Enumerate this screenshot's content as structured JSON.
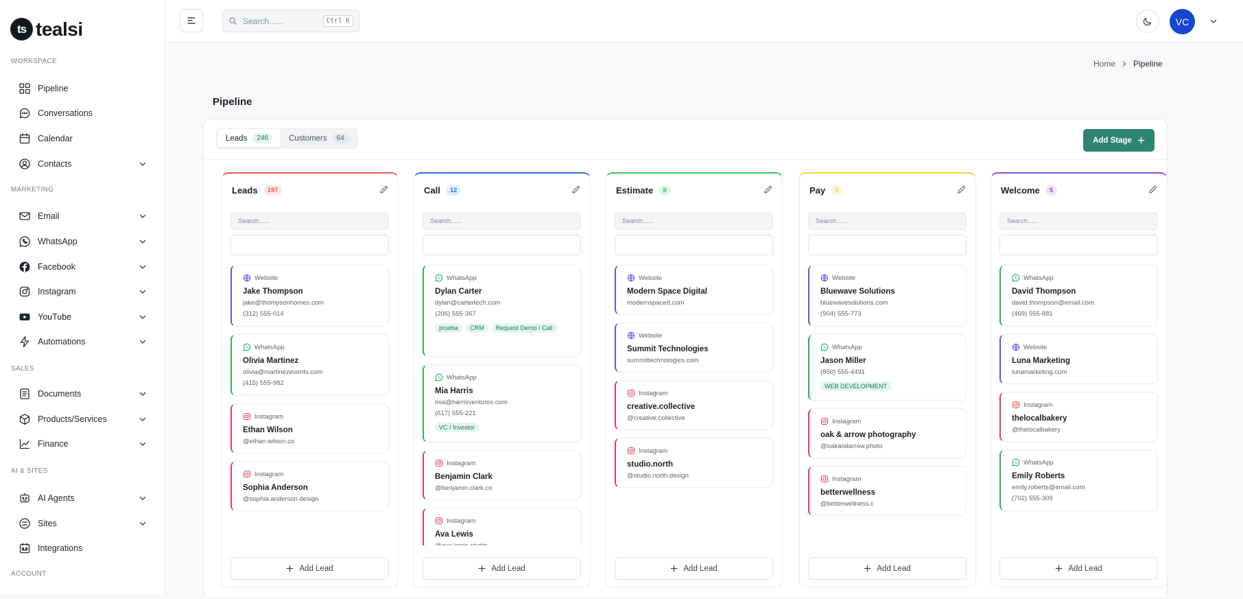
{
  "sidebar": {
    "logo_mark": "ts",
    "logo_text": "tealsi",
    "sections": {
      "workspace": "WORKSPACE",
      "marketing": "MARKETING",
      "sales": "SALES",
      "ai_sites": "AI & SITES",
      "account": "ACCOUNT"
    },
    "items": [
      {
        "label": "Pipeline",
        "icon": "grid-icon"
      },
      {
        "label": "Conversations",
        "icon": "chat-icon"
      },
      {
        "label": "Calendar",
        "icon": "calendar-icon"
      },
      {
        "label": "Contacts",
        "icon": "user-circle-icon",
        "expandable": true
      },
      {
        "label": "Email",
        "icon": "mail-icon",
        "expandable": true
      },
      {
        "label": "WhatsApp",
        "icon": "whatsapp-icon",
        "expandable": true
      },
      {
        "label": "Facebook",
        "icon": "facebook-icon",
        "expandable": true
      },
      {
        "label": "Instagram",
        "icon": "instagram-icon",
        "expandable": true
      },
      {
        "label": "YouTube",
        "icon": "youtube-icon",
        "expandable": true
      },
      {
        "label": "Automations",
        "icon": "bolt-icon",
        "expandable": true
      },
      {
        "label": "Documents",
        "icon": "document-icon",
        "expandable": true
      },
      {
        "label": "Products/Services",
        "icon": "box-icon",
        "expandable": true
      },
      {
        "label": "Finance",
        "icon": "chart-line-icon",
        "expandable": true
      },
      {
        "label": "AI Agents",
        "icon": "robot-icon",
        "expandable": true
      },
      {
        "label": "Sites",
        "icon": "globe-icon",
        "expandable": true
      },
      {
        "label": "Integrations",
        "icon": "integrations-icon"
      }
    ]
  },
  "topbar": {
    "search_placeholder": "Search......",
    "shortcut": "Ctrl K",
    "avatar_initials": "VC"
  },
  "breadcrumb": {
    "home": "Home",
    "current": "Pipeline"
  },
  "page": {
    "title": "Pipeline"
  },
  "tabs": [
    {
      "label": "Leads",
      "count": "246"
    },
    {
      "label": "Customers",
      "count": "64"
    }
  ],
  "add_stage_label": "Add Stage",
  "column_search_placeholder": "Search......",
  "add_lead_label": "Add Lead",
  "colors": {
    "accent": "#2f8373",
    "website": "#6b4fd8",
    "whatsapp": "#23b35a",
    "instagram": "#e0395a"
  },
  "columns": [
    {
      "title": "Leads",
      "count": "197",
      "color": "#e35a5a",
      "badge_bg": "#fde8e8",
      "cards": [
        {
          "source": "Website",
          "name": "Jake Thompson",
          "lines": [
            "jake@thompsonhomes.com",
            "(312) 555-014"
          ],
          "tags": []
        },
        {
          "source": "WhatsApp",
          "name": "Olivia Martinez",
          "lines": [
            "olivia@martinezevents.com",
            "(415) 555-982"
          ],
          "tags": []
        },
        {
          "source": "Instagram",
          "name": "Ethan Wilson",
          "lines": [
            "@ethan.wilson.co"
          ],
          "tags": []
        },
        {
          "source": "Instagram",
          "name": "Sophia Anderson",
          "lines": [
            "@sophia.anderson.design"
          ],
          "tags": []
        }
      ]
    },
    {
      "title": "Call",
      "count": "12",
      "color": "#2f6fe0",
      "badge_bg": "#e3edfc",
      "cards": [
        {
          "source": "WhatsApp",
          "name": "Dylan Carter",
          "lines": [
            "dylan@cartertech.com",
            "(206) 555-367"
          ],
          "tags": [
            "prueba",
            "CRM",
            "Request Demo / Call"
          ]
        },
        {
          "source": "WhatsApp",
          "name": "Mia Harris",
          "lines": [
            "mia@harrisventures.com",
            "(617) 555-221"
          ],
          "tags": [
            "VC / Investor"
          ]
        },
        {
          "source": "Instagram",
          "name": "Benjamin Clark",
          "lines": [
            "@benjamin.clark.co"
          ],
          "tags": []
        },
        {
          "source": "Instagram",
          "name": "Ava Lewis",
          "lines": [
            "@ava.lewis.studio"
          ],
          "tags": []
        }
      ]
    },
    {
      "title": "Estimate",
      "count": "9",
      "color": "#35c46a",
      "badge_bg": "#e2f6ea",
      "cards": [
        {
          "source": "Website",
          "name": "Modern Space Digital",
          "lines": [
            "modernspaced.com"
          ],
          "tags": []
        },
        {
          "source": "Website",
          "name": "Summit Technologies",
          "lines": [
            "summittechnologies.com"
          ],
          "tags": []
        },
        {
          "source": "Instagram",
          "name": "creative.collective",
          "lines": [
            "@creative.collective"
          ],
          "tags": []
        },
        {
          "source": "Instagram",
          "name": "studio.north",
          "lines": [
            "@studio.north.design"
          ],
          "tags": []
        }
      ]
    },
    {
      "title": "Pay",
      "count": "7",
      "color": "#e8d83a",
      "badge_bg": "#fbf6d6",
      "cards": [
        {
          "source": "Website",
          "name": "Bluewave Solutions",
          "lines": [
            "bluewavesolutions.com",
            "(904) 555-773"
          ],
          "tags": []
        },
        {
          "source": "WhatsApp",
          "name": "Jason Miller",
          "lines": [
            "(850) 555-4491"
          ],
          "tags": [
            "WEB DEVELOPMENT"
          ]
        },
        {
          "source": "Instagram",
          "name": "oak & arrow photography",
          "lines": [
            "@oakandarrow.photo"
          ],
          "tags": []
        },
        {
          "source": "Instagram",
          "name": "betterwellness",
          "lines": [
            "@betterwellness.c"
          ],
          "tags": []
        }
      ]
    },
    {
      "title": "Welcome",
      "count": "5",
      "color": "#8a4fe0",
      "badge_bg": "#efe6fc",
      "cards": [
        {
          "source": "WhatsApp",
          "name": "David Thompson",
          "lines": [
            "david.thompson@email.com",
            "(469) 555-881"
          ],
          "tags": []
        },
        {
          "source": "Website",
          "name": "Luna Marketing",
          "lines": [
            "lunamarketing.com"
          ],
          "tags": []
        },
        {
          "source": "Instagram",
          "name": "thelocalbakery",
          "lines": [
            "@thelocalbakery"
          ],
          "tags": []
        },
        {
          "source": "WhatsApp",
          "name": "Emily Roberts",
          "lines": [
            "emily.roberts@email.com",
            "(702) 555-309"
          ],
          "tags": []
        }
      ]
    }
  ]
}
